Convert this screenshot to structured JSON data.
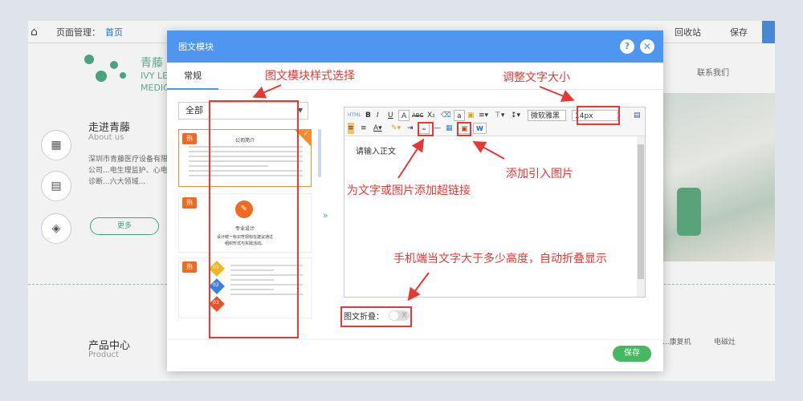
{
  "topbar": {
    "page_manage_label": "页面管理：",
    "current_page": "首页",
    "recycle_label": "回收站",
    "save_label": "保存"
  },
  "site": {
    "logo_text": "青藤",
    "logo_en_1": "IVY LE",
    "logo_en_2": "MEDIC",
    "nav_contact": "联系我们",
    "about_title": "走进青藤",
    "about_en": "About us",
    "about_text": "深圳市青藤医疗设备有限公司...电生理监护、心电诊断...六大领域...",
    "more_label": "更多",
    "product_title": "产品中心",
    "product_en": "Product",
    "category_1": "...康复机",
    "category_2": "电磁灶"
  },
  "modal": {
    "title": "图文模块",
    "tab_general": "常规",
    "category_select": "全部",
    "hot_badge": "热",
    "tpl1_title": "公司简介",
    "tpl2_title": "专业设计",
    "tpl2_sub_1": "设计统一标识符现标在建议通过",
    "tpl2_sub_2": "组织形式与实践活动。",
    "tpl3_items": [
      "01",
      "02",
      "03"
    ],
    "editor_placeholder": "请输入正文",
    "font_family": "微软雅黑",
    "font_size": "14px",
    "fold_label": "图文折叠：",
    "fold_state": "关",
    "save_label": "保存"
  },
  "annotations": {
    "style_select": "图文模块样式选择",
    "font_size": "调整文字大小",
    "add_image": "添加引入图片",
    "hyperlink": "为文字或图片添加超链接",
    "fold_desc": "手机端当文字大于多少高度，自动折叠显示"
  },
  "colors": {
    "modal_header": "#4f96f0",
    "annotation": "#e53935",
    "save_green": "#47b85e",
    "hot_orange": "#f26a20",
    "brand_green": "#4aa37e"
  }
}
